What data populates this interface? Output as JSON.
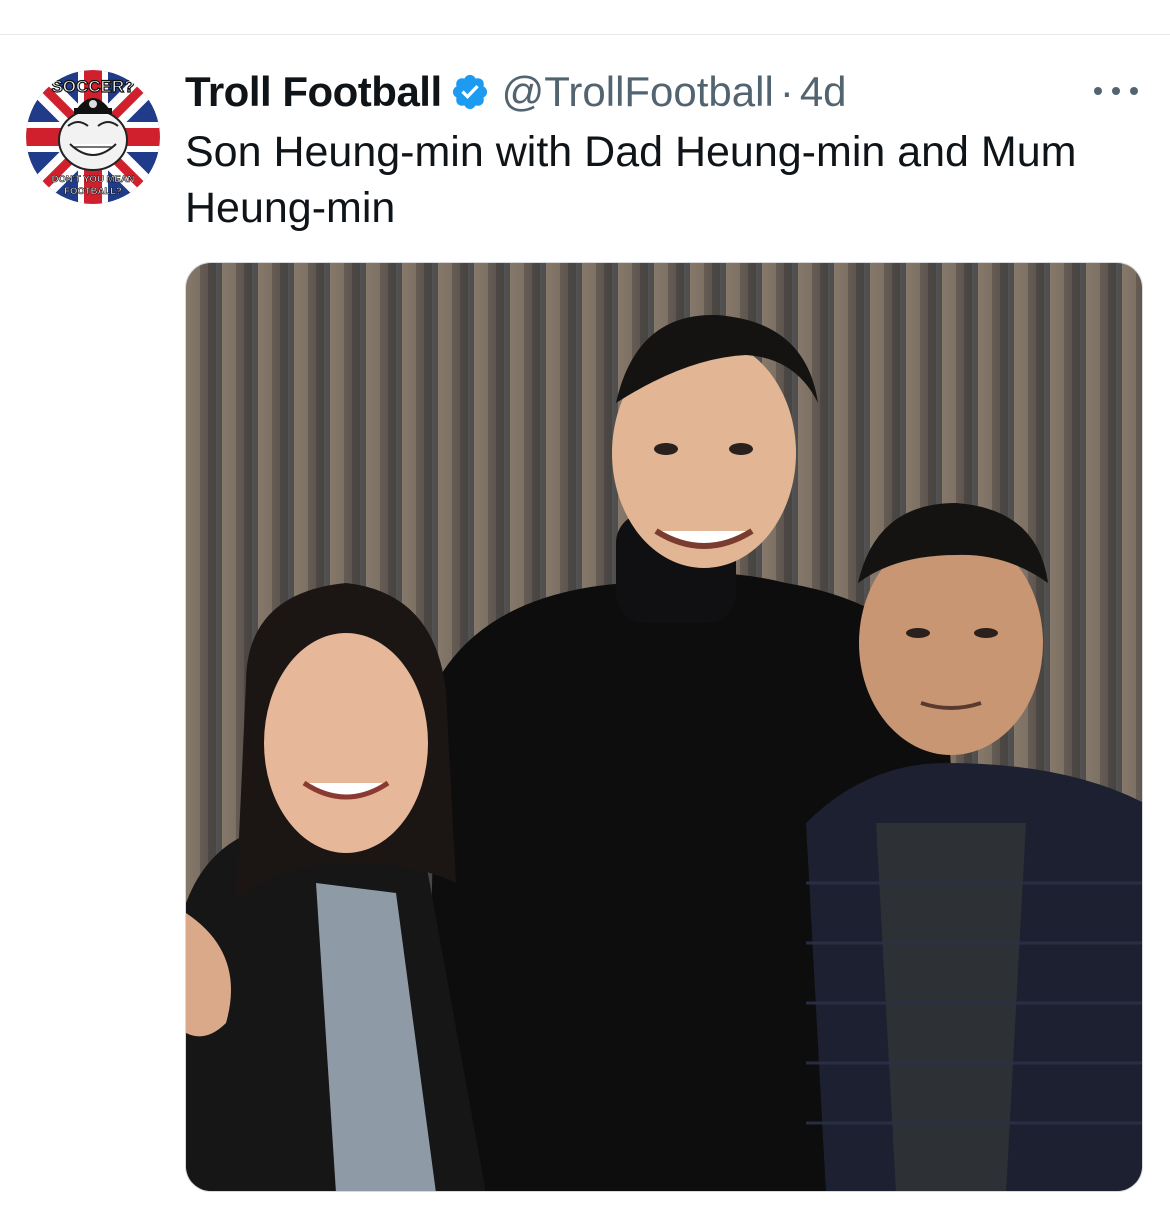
{
  "tweet": {
    "display_name": "Troll Football",
    "handle": "@TrollFootball",
    "separator": "·",
    "time": "4d",
    "text": "Son Heung-min with Dad Heung-min and Mum Heung-min",
    "verified": true,
    "avatar": {
      "top_text": "SOCCER?",
      "bottom_text_1": "DON'T YOU MEAN",
      "bottom_text_2": "FOOTBALL?"
    },
    "media": {
      "type": "photo",
      "description_icon": "photo-three-people-icon"
    }
  },
  "colors": {
    "text_primary": "#0f1419",
    "text_secondary": "#536471",
    "verified_blue": "#1d9bf0",
    "divider": "#e6e9ec"
  },
  "icons": {
    "verified": "verified-badge-icon",
    "more": "more-dots-icon"
  }
}
